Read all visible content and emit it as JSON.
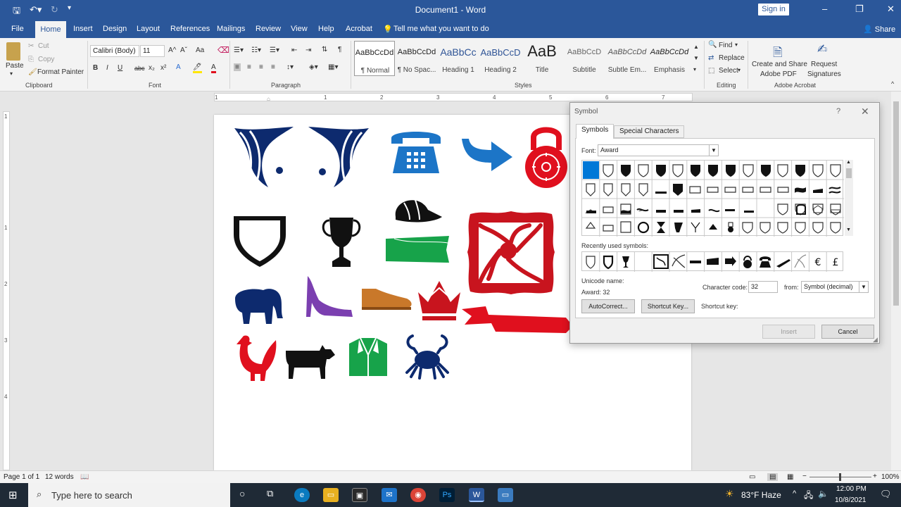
{
  "window": {
    "title": "Document1  -  Word",
    "signin": "Sign in",
    "minimize": "–",
    "maximize": "❐",
    "close": "✕"
  },
  "tabs": [
    "File",
    "Home",
    "Insert",
    "Design",
    "Layout",
    "References",
    "Mailings",
    "Review",
    "View",
    "Help",
    "Acrobat"
  ],
  "tell_me": "Tell me what you want to do",
  "share": "Share",
  "clipboard": {
    "paste": "Paste",
    "cut": "Cut",
    "copy": "Copy",
    "format_painter": "Format Painter",
    "label": "Clipboard"
  },
  "font": {
    "name": "Calibri (Body)",
    "size": "11",
    "label": "Font",
    "bold": "B",
    "italic": "I",
    "underline": "U",
    "strike": "abc",
    "subscript": "x₂",
    "superscript": "x²",
    "grow": "A^",
    "shrink": "Aˇ",
    "case": "Aa"
  },
  "paragraph": {
    "label": "Paragraph",
    "pilcrow": "¶"
  },
  "styles": {
    "label": "Styles",
    "items": [
      {
        "sample": "AaBbCcDd",
        "name": "¶ Normal"
      },
      {
        "sample": "AaBbCcDd",
        "name": "¶ No Spac..."
      },
      {
        "sample": "AaBbCc",
        "name": "Heading 1"
      },
      {
        "sample": "AaBbCcD",
        "name": "Heading 2"
      },
      {
        "sample": "AaB",
        "name": "Title"
      },
      {
        "sample": "AaBbCcD",
        "name": "Subtitle"
      },
      {
        "sample": "AaBbCcDd",
        "name": "Subtle Em..."
      },
      {
        "sample": "AaBbCcDd",
        "name": "Emphasis"
      }
    ]
  },
  "editing": {
    "find": "Find",
    "replace": "Replace",
    "select": "Select",
    "label": "Editing"
  },
  "acrobat": {
    "create_line1": "Create and Share",
    "create_line2": "Adobe PDF",
    "request_line1": "Request",
    "request_line2": "Signatures",
    "label": "Adobe Acrobat"
  },
  "ruler_numbers": [
    "1",
    "1",
    "2",
    "3",
    "4",
    "5",
    "6",
    "7"
  ],
  "vruler_numbers": [
    "1",
    "1",
    "2",
    "3",
    "4"
  ],
  "colors": {
    "word_blue": "#2b579a",
    "navy": "#0d2a6e",
    "blue": "#1c75c7",
    "red": "#e0101e",
    "dark_red": "#c8141e",
    "green": "#17a34a",
    "purple": "#7b3fb0",
    "brown": "#c9782a"
  },
  "document_symbols": [
    "ornament-left-icon",
    "ornament-right-icon",
    "telephone-icon",
    "arrow-icon",
    "combination-lock-icon",
    "shield-icon",
    "trophy-icon",
    "cap-icon",
    "ribbon-banner-icon",
    "ornate-frame-icon",
    "elephant-icon",
    "high-heel-icon",
    "shoe-icon",
    "crown-icon",
    "red-banner-icon",
    "rooster-icon",
    "cow-icon",
    "jacket-icon",
    "crab-icon"
  ],
  "symbol_dialog": {
    "title": "Symbol",
    "help": "?",
    "close": "✕",
    "tab_symbols": "Symbols",
    "tab_special": "Special Characters",
    "font_label": "Font:",
    "font_value": "Award",
    "recent_label": "Recently used symbols:",
    "recent_symbols": [
      "shield",
      "shield-bold",
      "trophy",
      "blank",
      "frame",
      "ornament",
      "banner",
      "banner2",
      "arrow",
      "lock",
      "phone",
      "pen",
      "flourish",
      "€",
      "£"
    ],
    "unicode_name_label": "Unicode name:",
    "unicode_value": "Award: 32",
    "char_code_label": "Character code:",
    "char_code_value": "32",
    "from_label": "from:",
    "from_value": "Symbol (decimal)",
    "shortcut_key_label": "Shortcut key:",
    "autocorrect": "AutoCorrect...",
    "shortcut_key_button": "Shortcut Key...",
    "insert": "Insert",
    "cancel": "Cancel"
  },
  "status": {
    "page": "Page 1 of 1",
    "words": "12 words",
    "zoom": "100%"
  },
  "taskbar": {
    "search_placeholder": "Type here to search",
    "weather": "83°F  Haze",
    "time": "12:00 PM",
    "date": "10/8/2021"
  }
}
